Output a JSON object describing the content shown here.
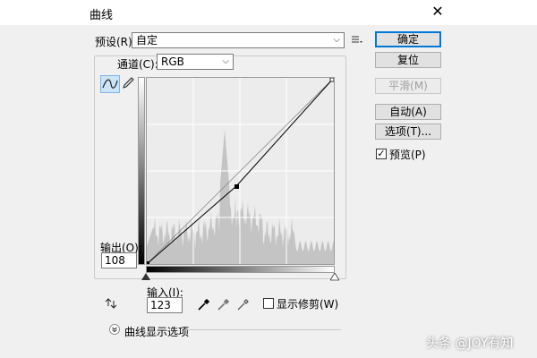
{
  "window": {
    "title": "曲线",
    "close_glyph": "✕"
  },
  "preset": {
    "label": "预设(R):",
    "value": "自定"
  },
  "channel": {
    "label": "通道(C):",
    "value": "RGB"
  },
  "buttons": {
    "ok": "确定",
    "reset": "复位",
    "smooth": "平滑(M)",
    "auto": "自动(A)",
    "options": "选项(T)..."
  },
  "preview": {
    "label": "预览(P)",
    "checked": true
  },
  "output": {
    "label": "输出(O):",
    "value": "108"
  },
  "input": {
    "label": "输入(I):",
    "value": "123"
  },
  "clipping": {
    "label": "显示修剪(W)",
    "checked": false
  },
  "curve_display_options": {
    "label": "曲线显示选项"
  },
  "watermark": "头条 @JOY有知",
  "colors": {
    "dialog_bg": "#f0f0f0",
    "histogram": "#c4c4c4",
    "curve": "#000000",
    "default_border": "#0078d7"
  },
  "icons": [
    "curve-point-tool-icon",
    "pencil-icon",
    "preset-options-icon",
    "black-eyedropper-icon",
    "gray-eyedropper-icon",
    "white-eyedropper-icon",
    "on-image-adjust-icon",
    "expand-options-icon"
  ]
}
